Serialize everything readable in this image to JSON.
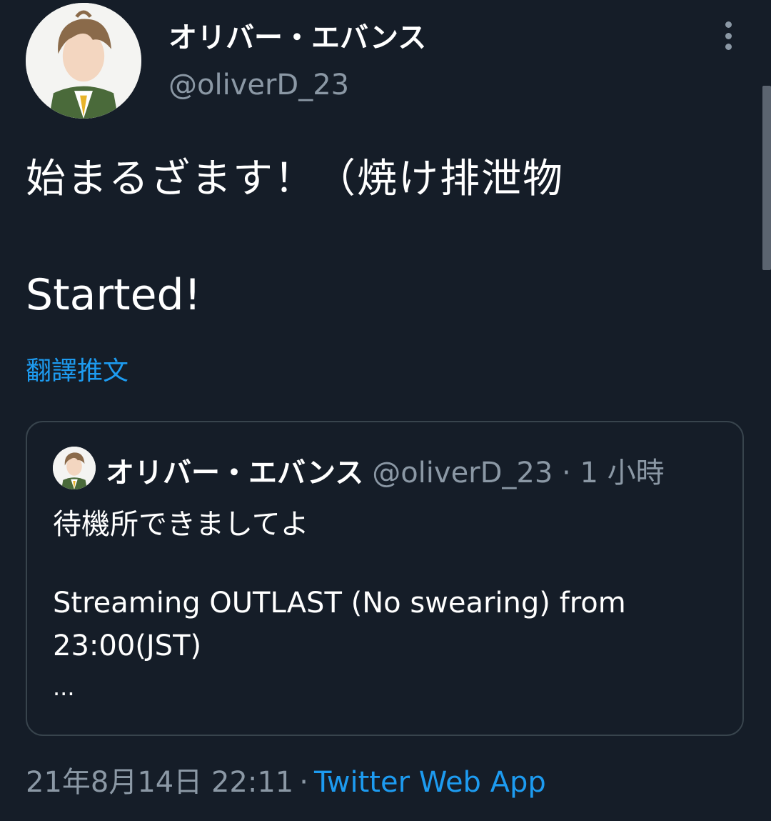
{
  "tweet": {
    "author": {
      "display_name": "オリバー・エバンス",
      "handle": "@oliverD_23",
      "avatar_icon": "user-avatar-icon"
    },
    "text_line1": "始まるざます！（焼け排泄物",
    "text_line2": "Started!",
    "translate_label": "翻譯推文",
    "timestamp": "21年8月14日 22:11",
    "separator": "·",
    "source": "Twitter Web App",
    "more_icon": "more-vertical-icon"
  },
  "quoted_tweet": {
    "display_name": "オリバー・エバンス",
    "meta": "@oliverD_23 · 1 小時",
    "text_line1": "待機所できましてよ",
    "text_line2": "Streaming OUTLAST (No swearing) from",
    "text_line3": "23:00(JST)",
    "ellipsis": "..."
  },
  "colors": {
    "background": "#151d28",
    "primary_text": "#ffffff",
    "secondary_text": "#8b98a5",
    "link": "#1d9bf0",
    "border": "#38444d"
  }
}
